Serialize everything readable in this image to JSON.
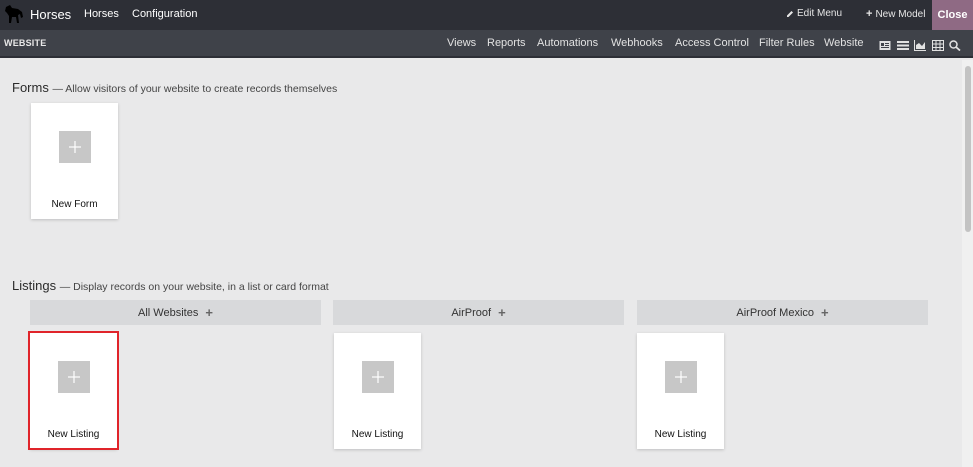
{
  "topbar": {
    "app_name": "Horses",
    "menu": [
      "Horses",
      "Configuration"
    ],
    "edit_menu": "Edit Menu",
    "new_model": "New Model",
    "close": "Close"
  },
  "subbar": {
    "title": "WEBSITE",
    "nav": [
      "Views",
      "Reports",
      "Automations",
      "Webhooks",
      "Access Control",
      "Filter Rules",
      "Website"
    ],
    "view_icons": [
      "form-view-icon",
      "list-view-icon",
      "graph-view-icon",
      "pivot-view-icon",
      "search-icon"
    ]
  },
  "forms": {
    "title": "Forms",
    "desc": "— Allow visitors of your website to create records themselves",
    "card_label": "New Form"
  },
  "listings": {
    "title": "Listings",
    "desc": "— Display records on your website, in a list or card format",
    "groups": [
      {
        "name": "All Websites",
        "card_label": "New Listing"
      },
      {
        "name": "AirProof",
        "card_label": "New Listing"
      },
      {
        "name": "AirProof Mexico",
        "card_label": "New Listing"
      }
    ]
  },
  "colors": {
    "navbar": "#2d2f36",
    "subbar": "#3f4249",
    "close_button": "#8f6a84",
    "highlight": "#e0242a"
  }
}
